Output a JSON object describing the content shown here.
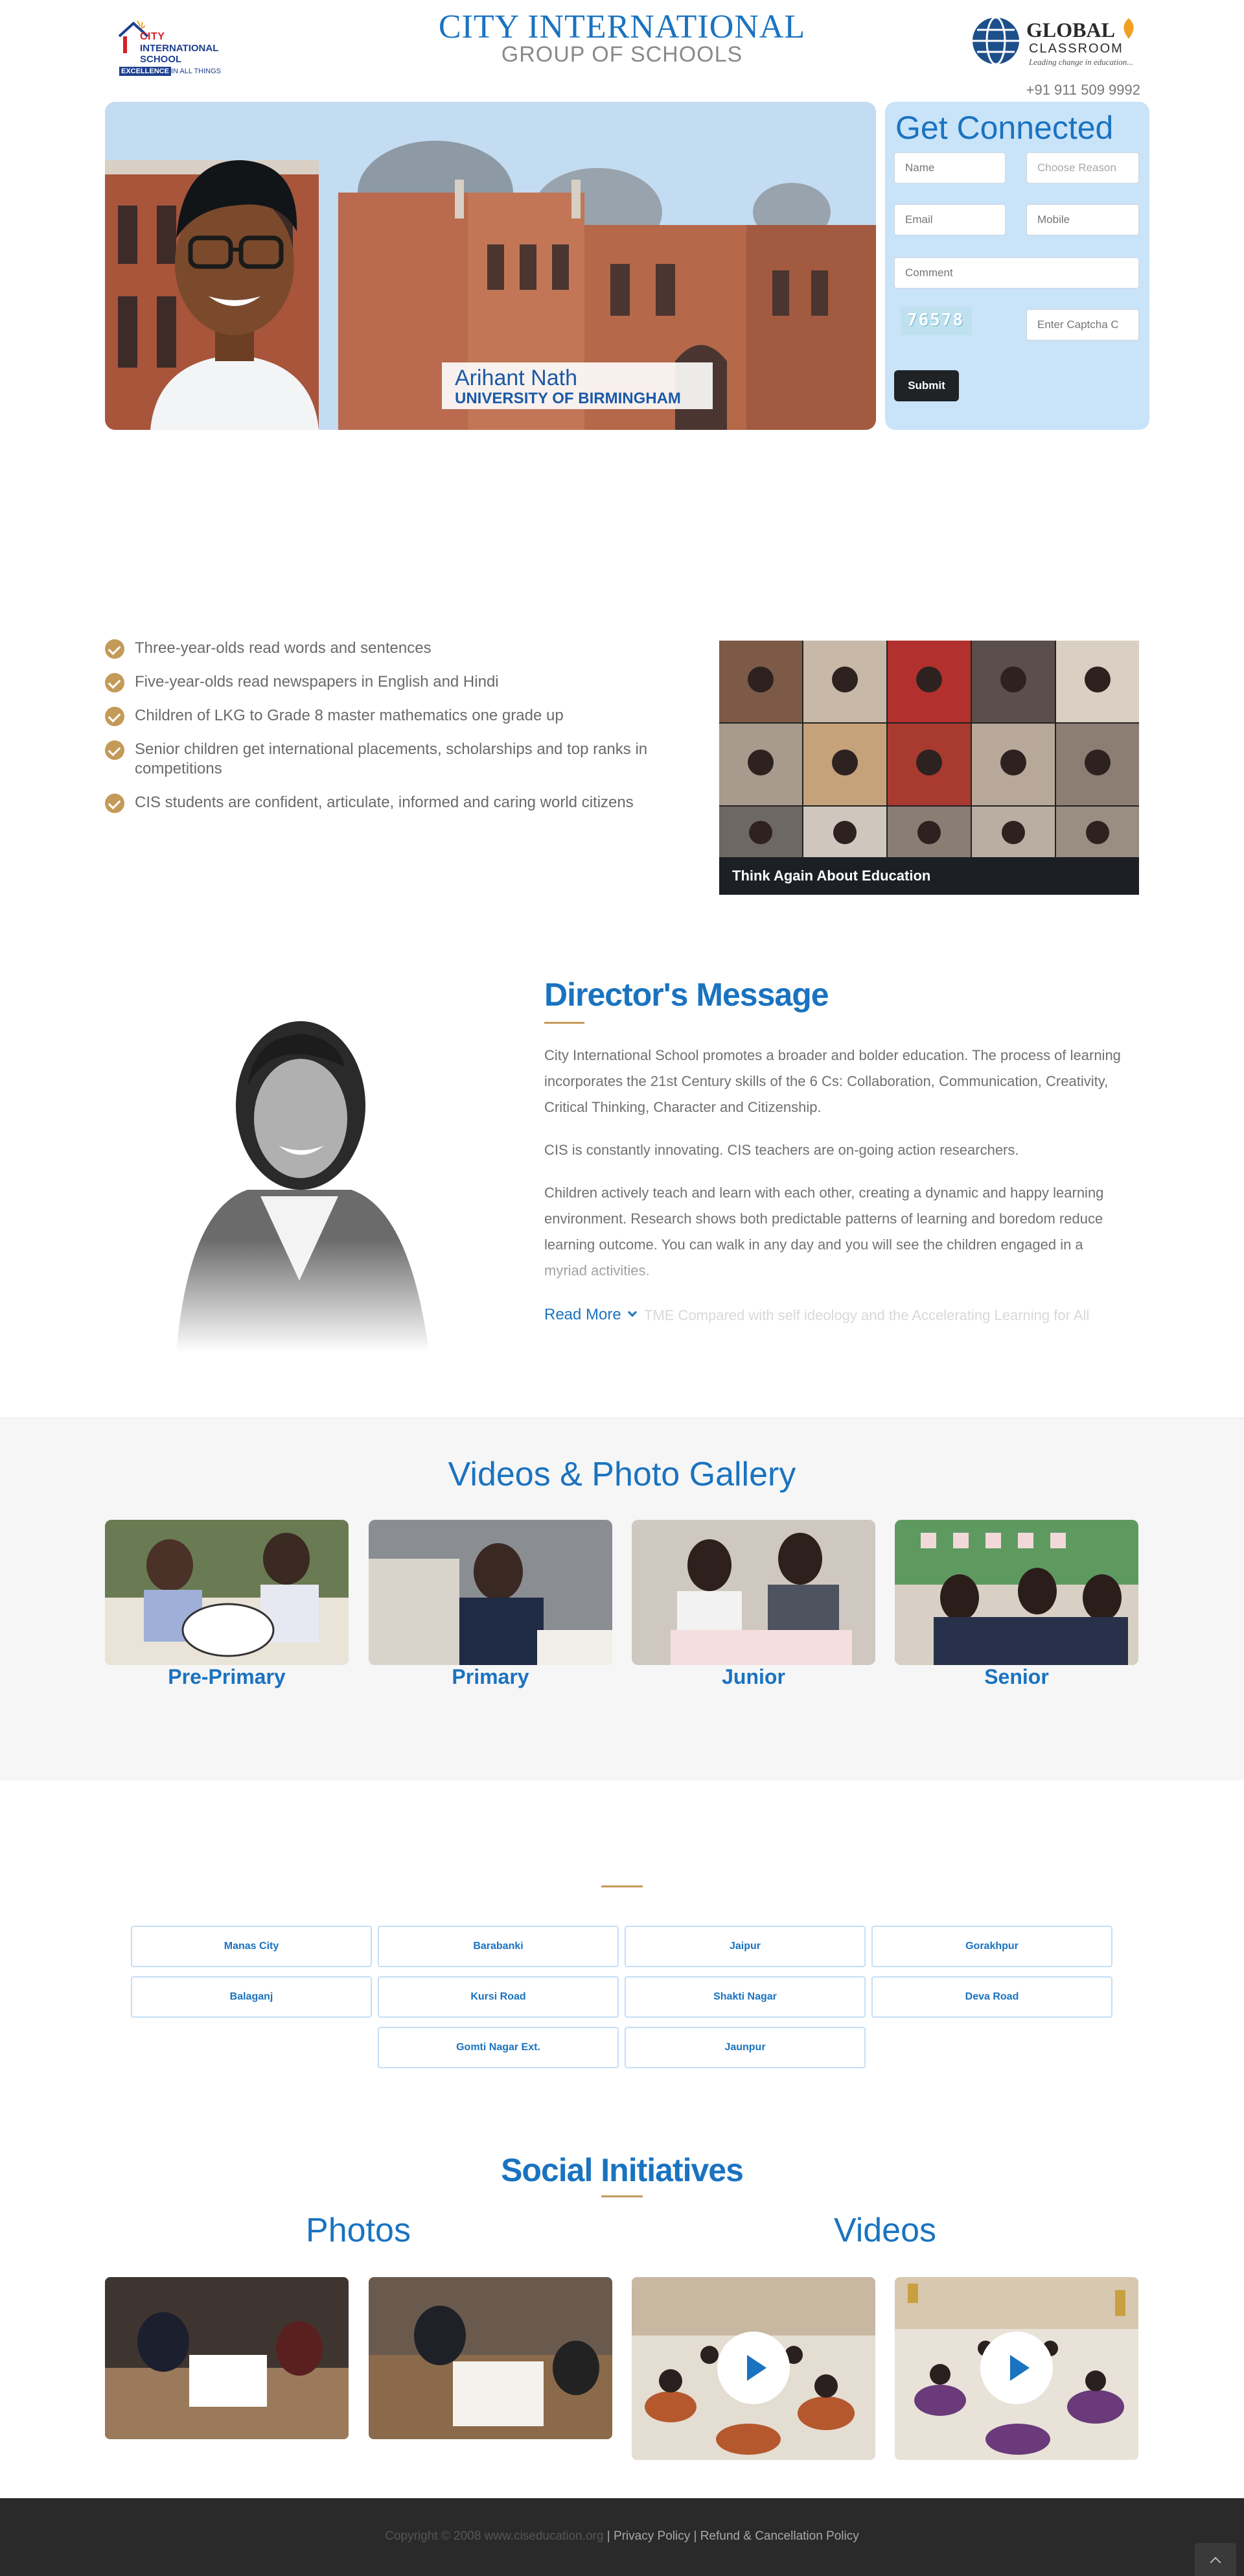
{
  "header": {
    "logo_left": {
      "line1": "CITY",
      "line2": "INTERNATIONAL",
      "line3": "SCHOOL",
      "tagline_a": "EXCELLENCE",
      "tagline_b": "IN ALL THINGS"
    },
    "title": "CITY INTERNATIONAL",
    "subtitle": "GROUP OF SCHOOLS",
    "logo_right": {
      "line1": "GLOBAL",
      "line2": "CLASSROOM",
      "tagline": "Leading change in education..."
    },
    "phone": "+91 911 509 9992"
  },
  "hero": {
    "student_name": "Arihant Nath",
    "university": "UNIVERSITY OF BIRMINGHAM"
  },
  "contact_form": {
    "title": "Get Connected",
    "name_placeholder": "Name",
    "reason_placeholder": "Choose Reason",
    "email_placeholder": "Email",
    "mobile_placeholder": "Mobile",
    "comment_placeholder": "Comment",
    "captcha_code": "76578",
    "captcha_placeholder": "Enter Captcha C",
    "submit_label": "Submit"
  },
  "features": [
    "Three-year-olds read words and sentences",
    "Five-year-olds read newspapers in English and Hindi",
    "Children of LKG to Grade 8 master mathematics one grade up",
    "Senior children get international placements, scholarships and top ranks in competitions",
    "CIS students are confident, articulate, informed and caring world citizens"
  ],
  "video_card": {
    "caption": "Think Again About Education"
  },
  "director": {
    "title": "Director's Message",
    "paragraphs": [
      "City International School promotes a broader and bolder education. The process of learning incorporates the 21st Century skills of the 6 Cs: Collaboration, Communication, Creativity, Critical Thinking, Character and Citizenship.",
      "CIS is constantly innovating. CIS teachers are on-going action researchers.",
      "Children actively teach and learn with each other, creating a dynamic and happy learning environment. Research shows both predictable patterns of learning and boredom reduce learning outcome. You can walk in any day and you will see the children engaged in a myriad activities."
    ],
    "read_more": "Read More",
    "faded_text": "TME Compared with self ideology and the Accelerating Learning for All"
  },
  "gallery": {
    "title": "Videos & Photo Gallery",
    "items": [
      {
        "label": "Pre-Primary"
      },
      {
        "label": "Primary"
      },
      {
        "label": "Junior"
      },
      {
        "label": "Senior"
      }
    ]
  },
  "locations": [
    "Manas City",
    "Barabanki",
    "Jaipur",
    "Gorakhpur",
    "Balaganj",
    "Kursi Road",
    "Shakti Nagar",
    "Deva Road",
    "Gomti Nagar Ext.",
    "Jaunpur"
  ],
  "social": {
    "title": "Social Initiatives",
    "photos_heading": "Photos",
    "videos_heading": "Videos"
  },
  "footer": {
    "copyright": "Copyright © 2008 www.ciseducation.org",
    "separator": "|",
    "privacy": "Privacy Policy",
    "refund": "Refund & Cancellation Policy"
  },
  "colors": {
    "brand_blue": "#1a73c0",
    "accent_gold": "#c39a58",
    "form_bg": "#c9e3f9",
    "footer_bg": "#2a2a2a"
  }
}
